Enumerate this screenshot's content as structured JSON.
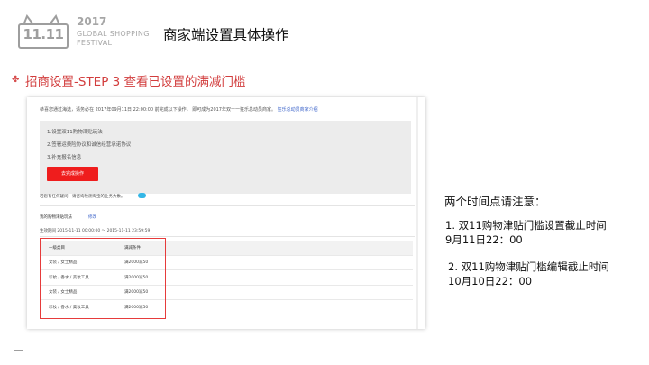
{
  "brand": {
    "logo_text": "11.11",
    "year": "2017",
    "line1": "GLOBAL SHOPPING",
    "line2": "FESTIVAL"
  },
  "page_title": "商家端设置具体操作",
  "section": {
    "icon": "star-bullet-icon",
    "title": "招商设置-STEP 3 查看已设置的满减门槛"
  },
  "screenshot": {
    "notice_prefix": "恭喜您通过海选，请务必在 2017年09月11日 22:00:00 前完成以下操作， 即可成为2017年双十一狂乐总动员商家。",
    "notice_link": "狂乐总动员商家介绍",
    "steps": [
      "1.设置双11购物津贴玩法",
      "2.签署运费险协议和诚信经营承诺协议",
      "3.补充报名信息"
    ],
    "go_button": "去完成操作",
    "faq": "若您有任何疑问，请咨询检测淘宝的业务大象。",
    "sub_title": "我的购物津贴玩法",
    "sub_link": "修改",
    "time_range": "生效期间 2015-11-11 00:00:00 ～ 2015-11-11 23:59:59",
    "table": {
      "headers": [
        "一级类目",
        "满减条件"
      ],
      "rows": [
        [
          "女装 / 女士精品",
          "满2000减50"
        ],
        [
          "彩妆 / 香水 / 美妆工具",
          "满2000减50"
        ],
        [
          "女装 / 女士精品",
          "满2000减50"
        ],
        [
          "彩妆 / 香水 / 美妆工具",
          "满2000减50"
        ]
      ]
    }
  },
  "notes": {
    "title": "两个时间点请注意：",
    "item1_line1": "1. 双11购物津贴门槛设置截止时间",
    "item1_line2": "9月11日22：00",
    "item2_line1": "2. 双11购物津贴门槛编辑截止时间",
    "item2_line2": "10月10日22：00"
  },
  "colors": {
    "accent": "#d23d3d",
    "button": "#ef1d1d",
    "link": "#3a62c9",
    "highlight_box": "#e63b3b"
  }
}
